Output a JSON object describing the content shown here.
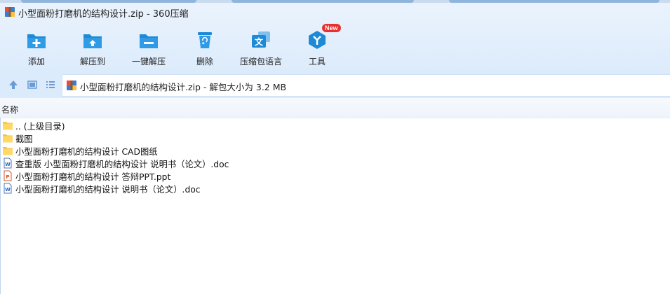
{
  "window": {
    "title": "小型面粉打磨机的结构设计.zip - 360压缩"
  },
  "toolbar": {
    "buttons": [
      {
        "label": "添加",
        "icon": "add-icon"
      },
      {
        "label": "解压到",
        "icon": "extract-to-icon"
      },
      {
        "label": "一键解压",
        "icon": "one-click-extract-icon"
      },
      {
        "label": "删除",
        "icon": "delete-icon"
      },
      {
        "label": "压缩包语言",
        "icon": "language-icon"
      },
      {
        "label": "工具",
        "icon": "tools-icon",
        "badge": "New"
      }
    ]
  },
  "navbar": {
    "path": "小型面粉打磨机的结构设计.zip - 解包大小为 3.2 MB"
  },
  "list": {
    "column_name": "名称",
    "items": [
      {
        "name": ".. (上级目录)",
        "type": "folder"
      },
      {
        "name": "截图",
        "type": "folder"
      },
      {
        "name": "小型面粉打磨机的结构设计 CAD图纸",
        "type": "folder"
      },
      {
        "name": "查重版 小型面粉打磨机的结构设计 说明书（论文）.doc",
        "type": "doc"
      },
      {
        "name": "小型面粉打磨机的结构设计 答辩PPT.ppt",
        "type": "ppt"
      },
      {
        "name": "小型面粉打磨机的结构设计 说明书（论文）.doc",
        "type": "doc"
      }
    ]
  },
  "colors": {
    "accent": "#1e8ad6",
    "header_bg": "#dcebfb",
    "folder": "#ffd866",
    "badge": "#e8312f"
  }
}
